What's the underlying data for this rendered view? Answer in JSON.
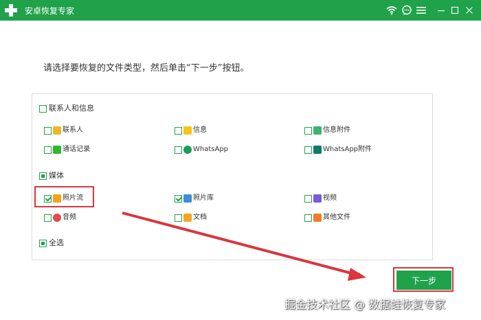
{
  "window": {
    "title": "安卓恢复专家",
    "controls": [
      "wifi-icon",
      "chat-icon",
      "menu-icon",
      "minimize-icon",
      "maximize-icon",
      "close-icon"
    ]
  },
  "instruction": "请选择要恢复的文件类型，然后单击“下一步”按钮。",
  "sections": [
    {
      "label": "联系人和信息",
      "state": "unchecked",
      "items": [
        {
          "label": "联系人",
          "icon": "contacts-icon",
          "color": "#f0b429",
          "checked": false
        },
        {
          "label": "信息",
          "icon": "messages-icon",
          "color": "#f5c518",
          "checked": false
        },
        {
          "label": "信息附件",
          "icon": "attachment-icon",
          "color": "#3cb371",
          "checked": false
        },
        {
          "label": "通话记录",
          "icon": "call-log-icon",
          "color": "#2eb82e",
          "checked": false
        },
        {
          "label": "WhatsApp",
          "icon": "whatsapp-icon",
          "color": "#1a9c5b",
          "checked": false
        },
        {
          "label": "WhatsApp附件",
          "icon": "whatsapp-attachment-icon",
          "color": "#0e7a6e",
          "checked": false
        }
      ]
    },
    {
      "label": "媒体",
      "state": "partial",
      "items": [
        {
          "label": "照片流",
          "icon": "photo-stream-icon",
          "color": "#f7a21b",
          "checked": true
        },
        {
          "label": "照片库",
          "icon": "photo-library-icon",
          "color": "#3a8fd6",
          "checked": true
        },
        {
          "label": "视频",
          "icon": "video-icon",
          "color": "#7b5cd6",
          "checked": false
        },
        {
          "label": "音频",
          "icon": "audio-icon",
          "color": "#e04b4b",
          "checked": false
        },
        {
          "label": "文档",
          "icon": "document-icon",
          "color": "#f5a623",
          "checked": false
        },
        {
          "label": "其他文件",
          "icon": "other-files-icon",
          "color": "#f07d2a",
          "checked": false
        }
      ]
    }
  ],
  "select_all": {
    "label": "全选",
    "state": "partial"
  },
  "next_button": "下一步",
  "watermark": "掘金技术社区 @ 数据蛙恢复专家",
  "colors": {
    "brand": "#1fa24a",
    "highlight": "#d9363e"
  }
}
